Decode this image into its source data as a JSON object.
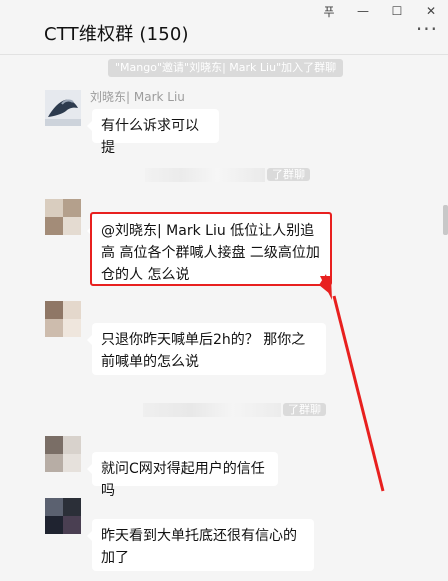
{
  "window": {
    "pin": "푸",
    "minimize": "—",
    "maximize": "☐",
    "close": "✕"
  },
  "header": {
    "title": "CTT维权群 (150)",
    "more": "···"
  },
  "notices": {
    "n1": "\"Mango\"邀请\"刘晓东| Mark Liu\"加入了群聊",
    "n2": "了群聊",
    "n3": "了群聊"
  },
  "messages": [
    {
      "sender": "刘晓东| Mark Liu",
      "text": "有什么诉求可以提"
    },
    {
      "sender": "",
      "text": "@刘晓东| Mark Liu  低位让人别追高 高位各个群喊人接盘 二级高位加仓的人 怎么说"
    },
    {
      "sender": "",
      "text": "只退你昨天喊单后2h的？  那你之前喊单的怎么说"
    },
    {
      "sender": "",
      "text": "就问C网对得起用户的信任吗"
    },
    {
      "sender": "",
      "text": "昨天看到大单托底还很有信心的加了"
    }
  ],
  "colors": {
    "highlight": "#e8201f",
    "bubble": "#ffffff",
    "background": "#f5f5f5"
  }
}
